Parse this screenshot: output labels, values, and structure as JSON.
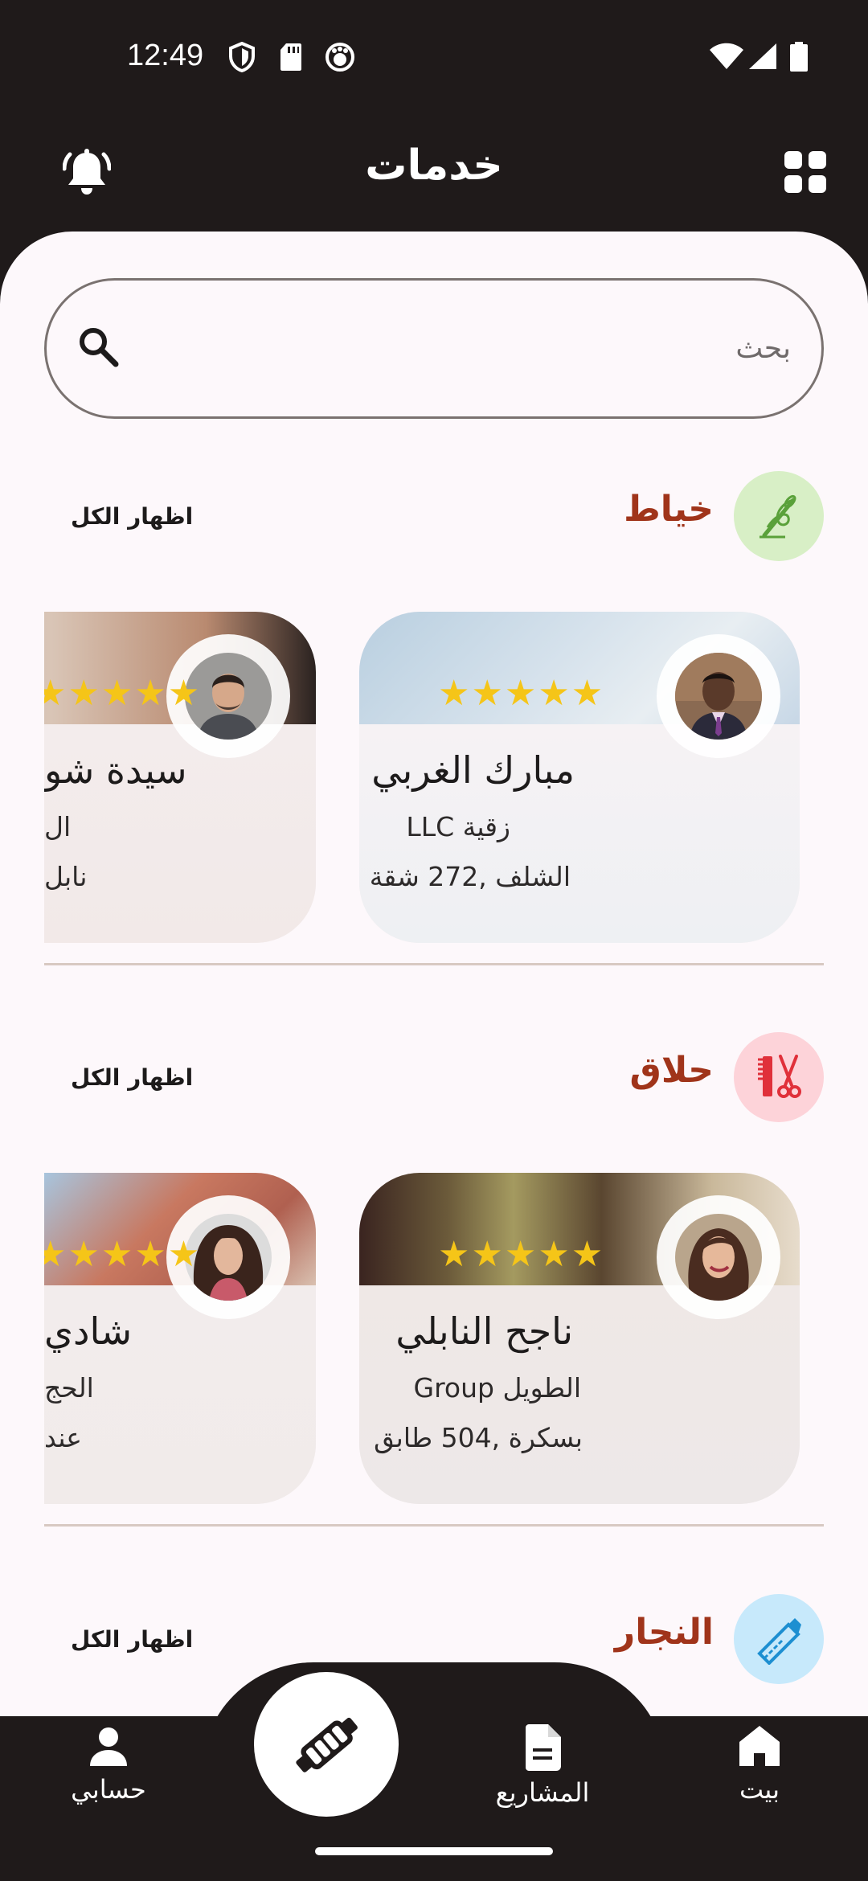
{
  "status_bar": {
    "time": "12:49"
  },
  "header": {
    "title": "خدمات"
  },
  "search": {
    "placeholder": "بحث"
  },
  "sections": [
    {
      "title": "خياط",
      "show_all": "اظهار الكل",
      "icon": "sewing-needle-icon",
      "icon_bg": "#d8efc6",
      "cards": [
        {
          "name": "مبارك الغربي",
          "line1": "زقية LLC",
          "line2": "الشلف ,272 شقة",
          "rating": 5
        },
        {
          "name": "سيدة شو",
          "line1": "ال",
          "line2": "نابل",
          "rating": 5
        }
      ]
    },
    {
      "title": "حلاق",
      "show_all": "اظهار الكل",
      "icon": "comb-scissors-icon",
      "icon_bg": "#fdd3d9",
      "cards": [
        {
          "name": "ناجح النابلي",
          "line1": "الطويل Group",
          "line2": "بسكرة ,504 طابق",
          "rating": 5
        },
        {
          "name": "شادي",
          "line1": "الحج",
          "line2": "عند",
          "rating": 5
        }
      ]
    },
    {
      "title": "النجار",
      "show_all": "اظهار الكل",
      "icon": "saw-icon",
      "icon_bg": "#c7e9fb"
    }
  ],
  "bottom_nav": {
    "account": "حسابي",
    "projects": "المشاريع",
    "home": "بيت"
  },
  "colors": {
    "accent": "#a0341a",
    "bar": "#1f1a1a",
    "star": "#f5c518"
  }
}
